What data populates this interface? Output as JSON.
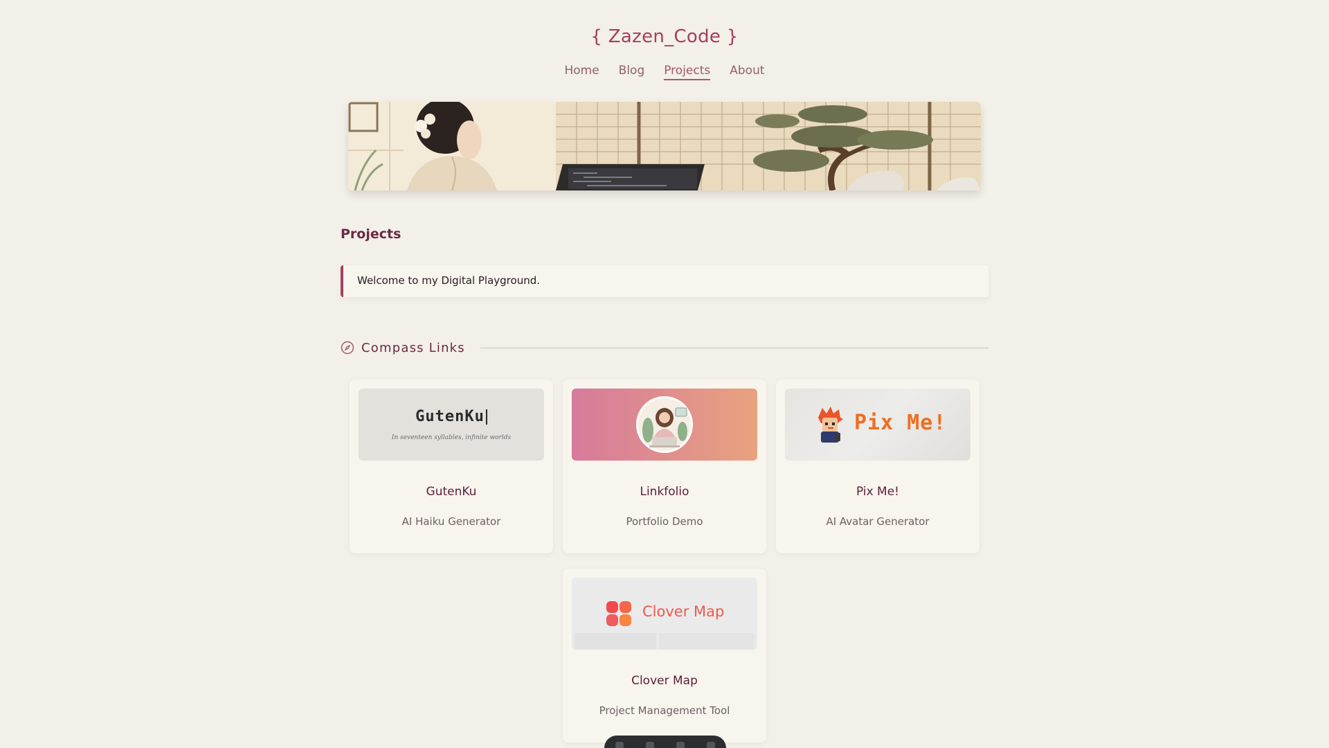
{
  "site": {
    "title": "{ Zazen_Code }"
  },
  "nav": [
    {
      "label": "Home",
      "active": false
    },
    {
      "label": "Blog",
      "active": false
    },
    {
      "label": "Projects",
      "active": true
    },
    {
      "label": "About",
      "active": false
    }
  ],
  "page": {
    "heading": "Projects",
    "welcome": "Welcome to my Digital Playground."
  },
  "section": {
    "title": "Compass Links",
    "icon": "compass-icon"
  },
  "projects": [
    {
      "name": "GutenKu",
      "description": "AI Haiku Generator",
      "thumb_title": "GutenKu",
      "thumb_subtitle": "In seventeen syllables, infinite worlds"
    },
    {
      "name": "Linkfolio",
      "description": "Portfolio Demo"
    },
    {
      "name": "Pix Me!",
      "description": "AI Avatar Generator",
      "thumb_title": "Pix Me!"
    },
    {
      "name": "Clover Map",
      "description": "Project Management Tool",
      "thumb_title": "Clover Map"
    }
  ],
  "colors": {
    "accent": "#a63e5f",
    "background": "#f3efe9",
    "card": "#f8f4ee",
    "heading": "#6b2a44"
  }
}
